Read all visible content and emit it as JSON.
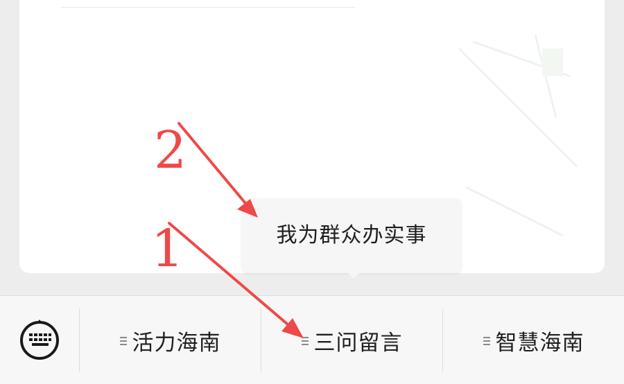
{
  "popup": {
    "label": "我为群众办实事"
  },
  "menubar": {
    "keyboard_icon": "keyboard-icon",
    "items": [
      {
        "label": "活力海南",
        "icon": "submenu-lines-icon"
      },
      {
        "label": "三问留言",
        "icon": "submenu-lines-icon"
      },
      {
        "label": "智慧海南",
        "icon": "submenu-lines-icon"
      }
    ]
  },
  "annotations": {
    "step_1": "1",
    "step_2": "2",
    "color": "#f04848"
  }
}
